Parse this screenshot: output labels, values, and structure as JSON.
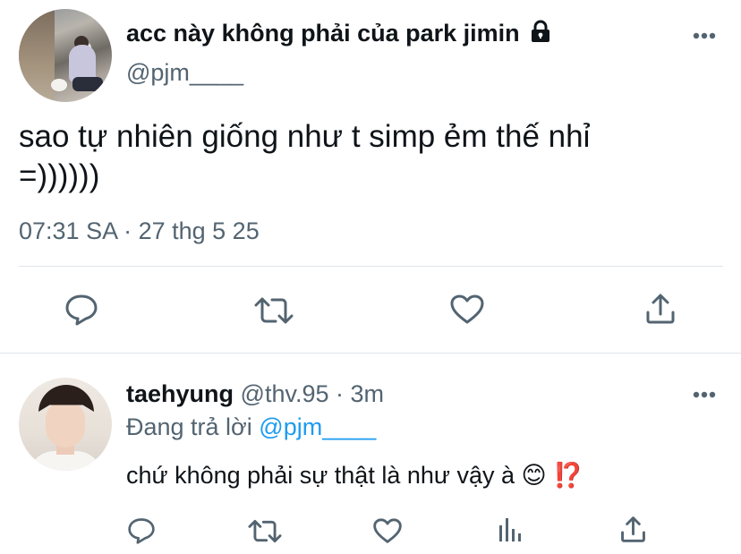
{
  "main_tweet": {
    "display_name": "acc này không phải của park jimin",
    "handle": "@pjm____",
    "text_line1": "sao tự nhiên giống như t simp ẻm thế nhỉ",
    "text_line2": "=))))))",
    "timestamp": "07:31 SA · 27 thg 5 25"
  },
  "reply": {
    "display_name": "taehyung",
    "handle": "@thv.95",
    "separator": "·",
    "time_ago": "3m",
    "replying_prefix": "Đang trả lời",
    "replying_to": "@pjm____",
    "text": "chứ không phải sự thật là như vậy à",
    "emoji_smile": "😊",
    "emoji_exclaim": "⁉️"
  },
  "icons": {
    "lock": "lock-icon",
    "more": "more-icon",
    "reply": "reply-icon",
    "retweet": "retweet-icon",
    "like": "like-icon",
    "share": "share-icon",
    "analytics": "analytics-icon"
  },
  "colors": {
    "text": "#0f1419",
    "secondary": "#536471",
    "link": "#1d9bf0",
    "divider": "#e1e5e9"
  }
}
